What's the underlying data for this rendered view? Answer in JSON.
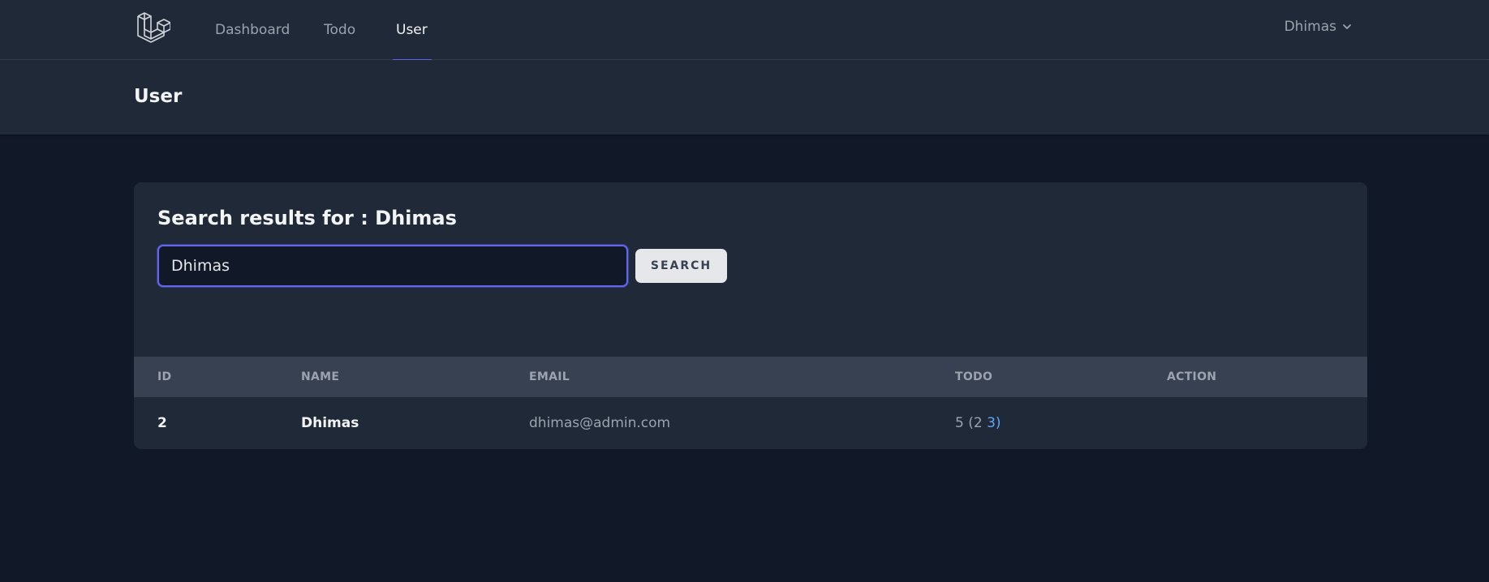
{
  "nav": {
    "links": [
      {
        "label": "Dashboard",
        "active": false
      },
      {
        "label": "Todo",
        "active": false
      },
      {
        "label": "User",
        "active": true
      }
    ],
    "user_name": "Dhimas",
    "user_icon": "chevron-down-icon",
    "logo_icon": "laravel-logo-icon"
  },
  "header": {
    "title": "User"
  },
  "search": {
    "heading": "Search results for : Dhimas",
    "value": "Dhimas",
    "button_label": "SEARCH"
  },
  "table": {
    "columns": [
      "ID",
      "NAME",
      "EMAIL",
      "TODO",
      "ACTION"
    ],
    "rows": [
      {
        "id": "2",
        "name": "Dhimas",
        "email": "dhimas@admin.com",
        "todo_total": "5 (2",
        "todo_link": "3)"
      }
    ]
  },
  "colors": {
    "background": "#111827",
    "panel": "#1f2937",
    "accent": "#6366f1",
    "link": "#60a5fa"
  }
}
